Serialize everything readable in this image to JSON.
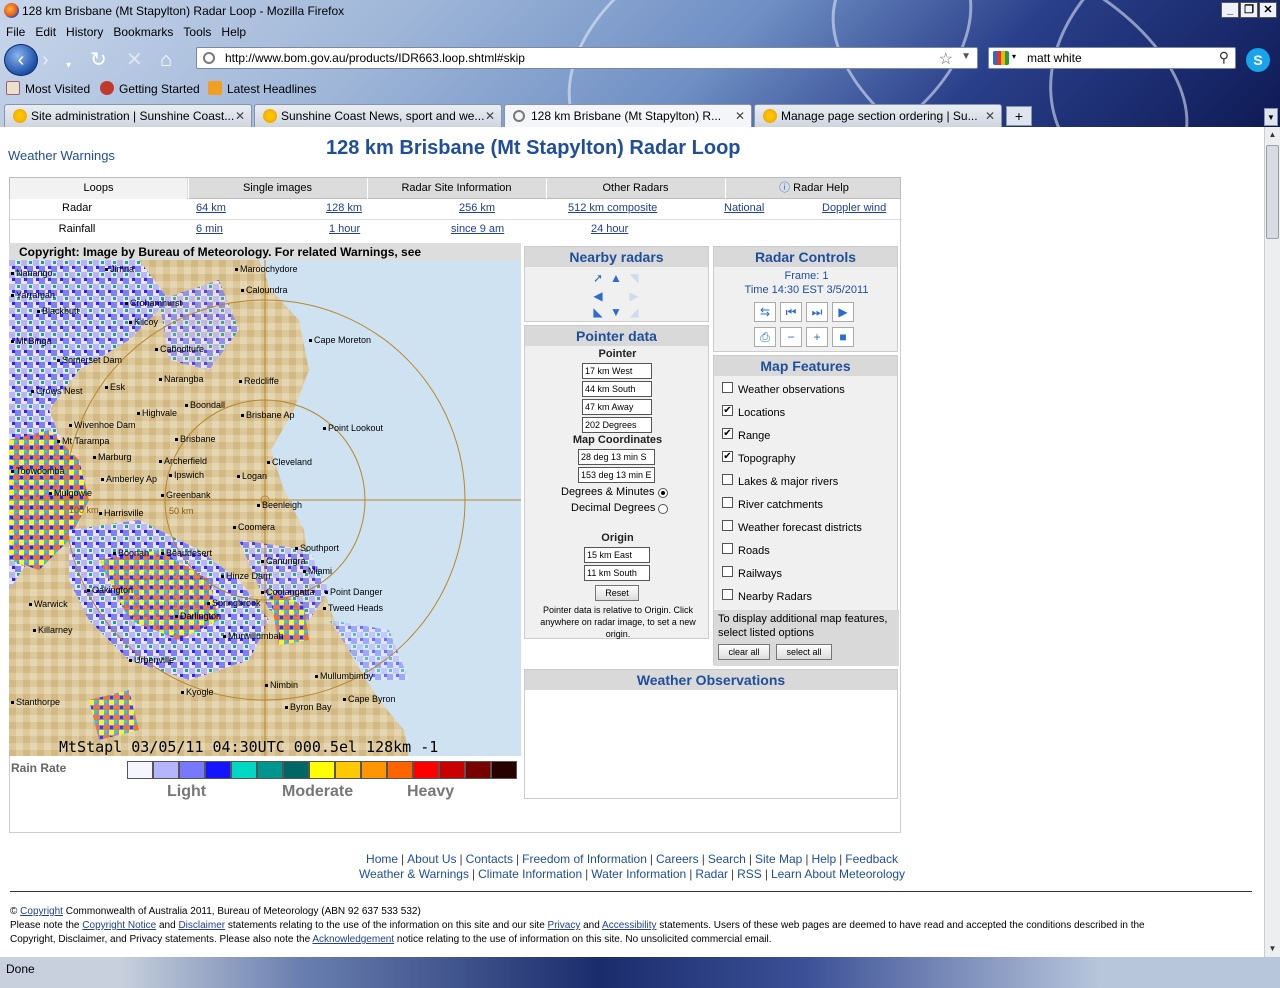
{
  "window": {
    "title": "128 km Brisbane (Mt Stapylton) Radar Loop - Mozilla Firefox"
  },
  "menu": [
    "File",
    "Edit",
    "History",
    "Bookmarks",
    "Tools",
    "Help"
  ],
  "nav": {
    "url": "http://www.bom.gov.au/products/IDR663.loop.shtml#skip",
    "search_value": "matt white"
  },
  "bookmarks": [
    "Most Visited",
    "Getting Started",
    "Latest Headlines"
  ],
  "tabs": [
    {
      "label": "Site administration | Sunshine Coast..."
    },
    {
      "label": "Sunshine Coast News, sport and we..."
    },
    {
      "label": "128 km Brisbane (Mt Stapylton) R..."
    },
    {
      "label": "Manage page section ordering | Su..."
    }
  ],
  "status": "Done",
  "page": {
    "warnings_link": "Weather Warnings",
    "title": "128 km Brisbane (Mt Stapylton) Radar Loop",
    "tabs": [
      "Loops",
      "Single images",
      "Radar Site Information",
      "Other Radars",
      "Radar Help"
    ],
    "radar_label": "Radar",
    "radar_links": [
      "64 km",
      "128 km",
      "256 km",
      "512 km composite",
      "National",
      "Doppler wind"
    ],
    "rainfall_label": "Rainfall",
    "rainfall_links": [
      "6 min",
      "1 hour",
      "since 9 am",
      "24 hour"
    ],
    "copyright_banner": "Copyright: Image by Bureau of Meteorology. For related Warnings, see www.bom.gov.au",
    "radar_stamp": "MtStapl 03/05/11 04:30UTC 000.5el 128km -1",
    "range_labels": [
      "100 km",
      "50 km"
    ],
    "towns": [
      "Nanango",
      "Jimna",
      "Maroochydore",
      "Caloundra",
      "Yarraman",
      "Crohamhurst",
      "Blackbutt",
      "Kilcoy",
      "Mt Binga",
      "Caboolture",
      "Cape Moreton",
      "Somerset Dam",
      "Narangba",
      "Esk",
      "Redcliffe",
      "Crows Nest",
      "Highvale",
      "Boondall",
      "Brisbane Ap",
      "Wivenhoe Dam",
      "Point Lookout",
      "Mt Tarampa",
      "Brisbane",
      "Marburg",
      "Archerfield",
      "Cleveland",
      "Toowoomba",
      "Amberley Ap",
      "Ipswich",
      "Logan",
      "Mulgowie",
      "Greenbank",
      "Beenleigh",
      "Harrisville",
      "Coomera",
      "Southport",
      "Boonah",
      "Beaudesert",
      "Canungra",
      "Hinze Dam",
      "Miami",
      "Oakington",
      "Coolangatta",
      "Point Danger",
      "Warwick",
      "Springbrook",
      "Tweed Heads",
      "Killarney",
      "Darlington",
      "Murwillumbah",
      "Urbenville",
      "Mullumbimby",
      "Kyogle",
      "Nimbin",
      "Cape Byron",
      "Stanthorpe",
      "Byron Bay"
    ],
    "legend": {
      "title": "Rain Rate",
      "light": "Light",
      "moderate": "Moderate",
      "heavy": "Heavy",
      "colors": [
        "#f5f5ff",
        "#b4b4ff",
        "#7878ff",
        "#1414ff",
        "#00d8c3",
        "#009690",
        "#006666",
        "#ffff00",
        "#ffc800",
        "#ff9600",
        "#ff6400",
        "#ff0000",
        "#c80000",
        "#780000",
        "#280000"
      ]
    },
    "nearby": {
      "title": "Nearby radars"
    },
    "pointer": {
      "title": "Pointer data",
      "pointer_label": "Pointer",
      "values": [
        "17 km West",
        "44 km South",
        "47 km Away",
        "202 Degrees"
      ],
      "map_coords_label": "Map Coordinates",
      "coords": [
        "28 deg 13 min S",
        "153 deg 13 min E"
      ],
      "opt_dm": "Degrees & Minutes",
      "opt_dd": "Decimal Degrees",
      "origin_label": "Origin",
      "origin": [
        "15 km East",
        "11 km South"
      ],
      "reset": "Reset",
      "note": "Pointer data is relative to Origin. Click anywhere on radar image, to set a new origin."
    },
    "controls": {
      "title": "Radar Controls",
      "frame": "Frame: 1",
      "time": "Time 14:30 EST 3/5/2011"
    },
    "features": {
      "title": "Map Features",
      "items": [
        {
          "label": "Weather observations",
          "checked": false
        },
        {
          "label": "Locations",
          "checked": true
        },
        {
          "label": "Range",
          "checked": true
        },
        {
          "label": "Topography",
          "checked": true
        },
        {
          "label": "Lakes & major rivers",
          "checked": false
        },
        {
          "label": "River catchments",
          "checked": false
        },
        {
          "label": "Weather forecast districts",
          "checked": false
        },
        {
          "label": "Roads",
          "checked": false
        },
        {
          "label": "Railways",
          "checked": false
        },
        {
          "label": "Nearby Radars",
          "checked": false
        }
      ],
      "note": "To display additional map features, select listed options",
      "clear": "clear all",
      "select": "select all"
    },
    "observations": {
      "title": "Weather Observations"
    },
    "footer1": [
      "Home",
      "About Us",
      "Contacts",
      "Freedom of Information",
      "Careers",
      "Search",
      "Site Map",
      "Help",
      "Feedback"
    ],
    "footer2": [
      "Weather & Warnings",
      "Climate Information",
      "Water Information",
      "Radar",
      "RSS",
      "Learn About Meteorology"
    ],
    "copy": {
      "l1a": "©",
      "l1link": "Copyright",
      "l1b": "Commonwealth of Australia 2011, Bureau of Meteorology (ABN 92 637 533 532)",
      "l2a": "Please note the",
      "l2_cn": "Copyright Notice",
      "l2_and": "and",
      "l2_disc": "Disclaimer",
      "l2b": "statements relating to the use of the information on this site and our site",
      "l2_priv": "Privacy",
      "l2_and2": "and",
      "l2_acc": "Accessibility",
      "l2c": "statements. Users of these web pages are deemed to have read and accepted the conditions described in the",
      "l3a": "Copyright, Disclaimer, and Privacy statements. Please also note the",
      "l3_ack": "Acknowledgement",
      "l3b": "notice relating to the use of information on this site. No unsolicited commercial email."
    }
  }
}
